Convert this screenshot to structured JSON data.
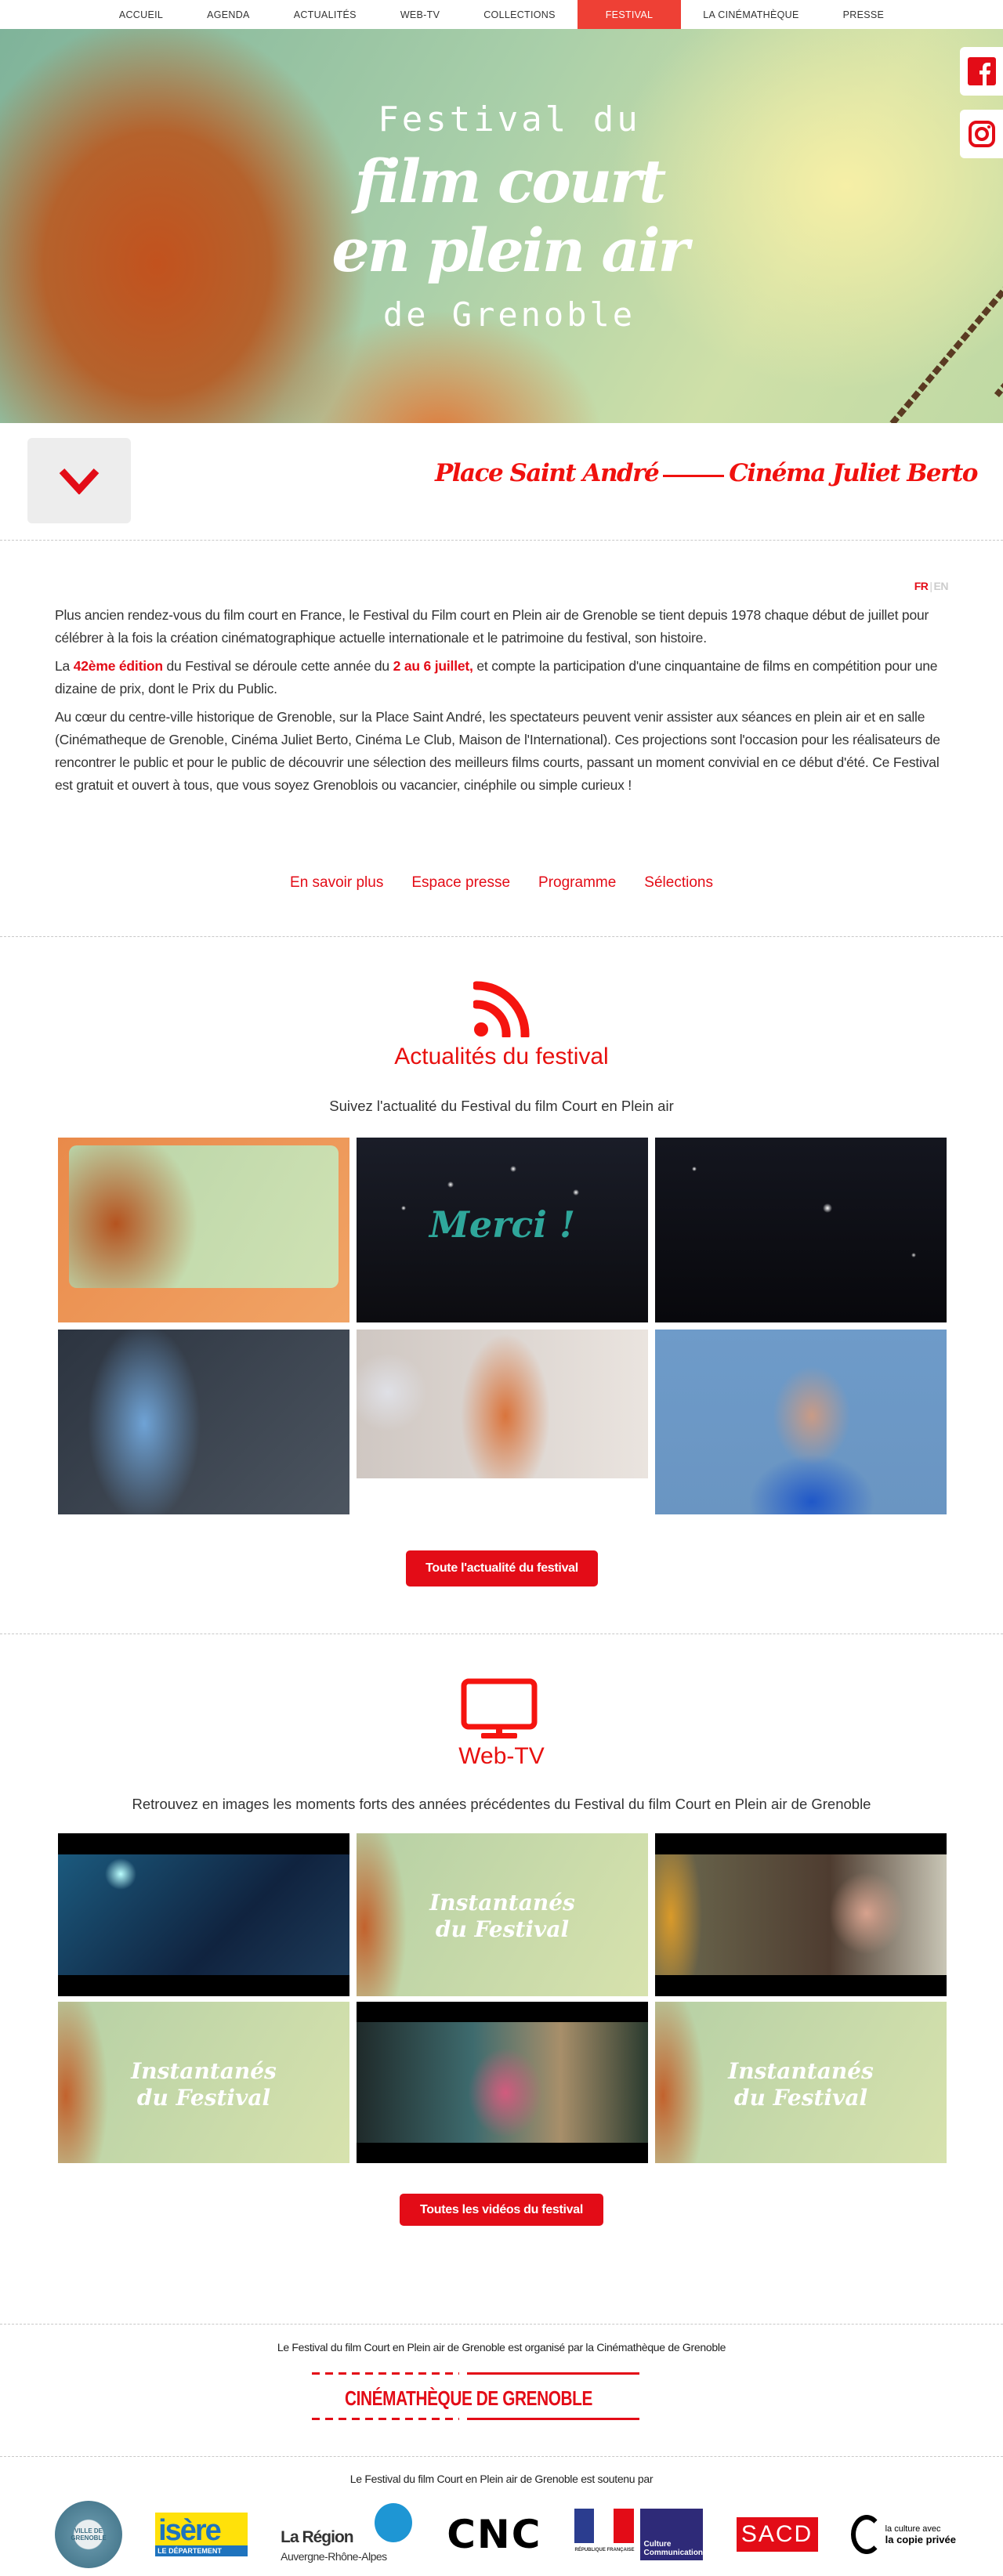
{
  "nav": {
    "items": [
      "ACCUEIL",
      "AGENDA",
      "ACTUALITÉS",
      "WEB-TV",
      "COLLECTIONS",
      "FESTIVAL",
      "LA CINÉMATHÈQUE",
      "PRESSE"
    ],
    "active": "FESTIVAL"
  },
  "hero": {
    "line1": "Festival du",
    "line2": "film court",
    "line3": "en plein air",
    "line4": "de Grenoble",
    "social": [
      "facebook-icon",
      "instagram-icon"
    ]
  },
  "venue": {
    "place": "Place Saint André",
    "cinema": "Cinéma Juliet Berto"
  },
  "lang": {
    "fr": "FR",
    "sep": "|",
    "en": "EN"
  },
  "intro": {
    "p1": "Plus ancien rendez-vous du film court en France, le Festival du Film court en Plein air de Grenoble se tient depuis 1978 chaque début de juillet pour célébrer à la fois la création cinématographique actuelle internationale et le patrimoine du festival, son histoire.",
    "p2_a": "La ",
    "p2_edition": "42ème édition",
    "p2_b": " du Festival se déroule cette année du ",
    "p2_dates": "2 au 6 juillet,",
    "p2_c": " et compte la participation d'une cinquantaine de films en compétition pour une dizaine de prix, dont le Prix du Public.",
    "p3": "Au cœur du centre-ville historique de Grenoble, sur la Place Saint André, les spectateurs peuvent venir assister aux séances en plein air et en salle (Cinématheque de Grenoble, Cinéma Juliet Berto, Cinéma Le Club, Maison de l'International). Ces projections sont l'occasion pour les réalisateurs de rencontrer le public et pour le public de découvrir une sélection des meilleurs films courts, passant un moment convivial en ce début d'été. Ce Festival est gratuit et ouvert à tous, que vous soyez Grenoblois ou vacancier, cinéphile ou simple curieux !"
  },
  "links": [
    "En savoir plus",
    "Espace presse",
    "Programme",
    "Sélections"
  ],
  "news": {
    "title": "Actualités du festival",
    "subtitle": "Suivez l'actualité du Festival du film Court en Plein air",
    "thumb_texts": {
      "merci": "Merci !"
    },
    "button": "Toute l'actualité du festival"
  },
  "webtv": {
    "title": "Web-TV",
    "subtitle": "Retrouvez en images les moments forts des années précédentes du Festival du film Court en Plein air de Grenoble",
    "thumb_text_1": "Instantanés",
    "thumb_text_2": "du Festival",
    "button": "Toutes les vidéos du festival"
  },
  "footer": {
    "organised_by": "Le Festival du film Court en Plein air de Grenoble est organisé par la Cinémathèque de Grenoble",
    "cinematheque_logo": "CINÉMATHÈQUE DE GRENOBLE",
    "supported_by": "Le Festival du film Court en Plein air de Grenoble est soutenu par",
    "logos": {
      "grenoble": "VILLE DE GRENOBLE",
      "isere": "isère",
      "isere_sub": "LE DÉPARTEMENT",
      "region": "La Région",
      "region_sub": "Auvergne-Rhône-Alpes",
      "cnc": "CNC",
      "rf": "RÉPUBLIQUE FRANÇAISE",
      "culture": "Culture Communication",
      "sacd": "SACD",
      "copie1": "la culture avec",
      "copie2": "la copie privée"
    }
  },
  "colors": {
    "accent": "#e30c17",
    "nav_active": "#ee4035"
  }
}
